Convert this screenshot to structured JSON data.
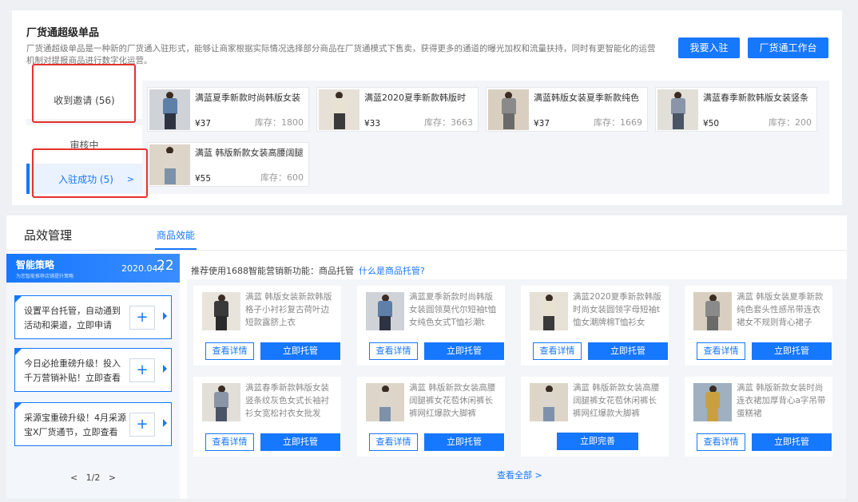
{
  "top": {
    "title": "厂货通超级单品",
    "desc": "厂货通超级单品是一种新的厂货通入驻形式，能够让商家根据实际情况选择部分商品在厂货通模式下售卖，获得更多的通道的曝光加权和流量扶持，同时有更智能化的运营机制对提报商品进行数字化运营。",
    "join_label": "我要入驻",
    "workbench_label": "厂货通工作台",
    "tabs": {
      "invite": "收到邀请 (56)",
      "review": "审核中",
      "success": "入驻成功 (5)",
      "success_chev": ">"
    },
    "products": [
      {
        "name": "满蓝夏季新款时尚韩版女装",
        "price": "¥37",
        "stock": "库存：1800",
        "top_color": "#5d7fa8",
        "bottom_color": "#2d3340",
        "bg": "#cfd3d8"
      },
      {
        "name": "满蓝2020夏季新款韩版时",
        "price": "¥33",
        "stock": "库存：3663",
        "top_color": "#e8e2d2",
        "bottom_color": "#3a3a3a",
        "bg": "#e6e0d6"
      },
      {
        "name": "满蓝韩版女装夏季新款纯色",
        "price": "¥37",
        "stock": "库存：1669",
        "top_color": "#8a8a8a",
        "bottom_color": "#6a6a6a",
        "bg": "#d8cfc0"
      },
      {
        "name": "满蓝春季新款韩版女装竖条",
        "price": "¥50",
        "stock": "库存：200",
        "top_color": "#8a95a8",
        "bottom_color": "#4b5466",
        "bg": "#e2dfd8"
      },
      {
        "name": "满蓝 韩版新款女装高腰阔腿",
        "price": "¥55",
        "stock": "库存：600",
        "top_color": "#dcd6cc",
        "bottom_color": "#7d91aa",
        "bg": "#ddd5c8"
      }
    ]
  },
  "perf": {
    "title": "品效管理",
    "tab": "商品效能",
    "strategy": {
      "title": "智能策略",
      "subtitle": "为您智能推荐店铺提升策略",
      "date": "2020.04 /",
      "day": "22",
      "cards": [
        {
          "text": "设置平台托管，自动通到活动和渠道，立即申请",
          "plus": "+"
        },
        {
          "text": "今日必抢重磅升级！投入千万营销补贴！立即查看",
          "plus": "+"
        },
        {
          "text": "采源宝重磅升级！4月采源宝X厂货通节，立即查看",
          "plus": "+"
        }
      ],
      "pager": "<   1/2   >"
    },
    "reco_text": "推荐使用1688智能营销新功能：商品托管",
    "reco_link": "什么是商品托管?",
    "detail_label": "查看详情",
    "host_label": "立即托管",
    "complete_label": "立即完善",
    "view_all": "查看全部 >",
    "items": [
      {
        "name": "满蓝 韩版女装新款韩版格子小衬衫复古荷叶边短款露脐上衣",
        "top_color": "#3a3a3a",
        "bottom_color": "#2a2a2a",
        "bg": "#e8e4dc"
      },
      {
        "name": "满蓝夏季新款时尚韩版女装圆领莫代尔短袖t恤女纯色女式T恤衫潮t",
        "top_color": "#5d7fa8",
        "bottom_color": "#2d3340",
        "bg": "#cfd3d8"
      },
      {
        "name": "满蓝2020夏季新款韩版时尚女装圆领字母短袖t恤女潮牌棉T恤衫女",
        "top_color": "#e8e2d2",
        "bottom_color": "#3a3a3a",
        "bg": "#e6e0d6"
      },
      {
        "name": "满蓝 韩版女装夏季新款纯色套头性感吊带连衣裙女不规则背心裙子",
        "top_color": "#8a8a8a",
        "bottom_color": "#6a6a6a",
        "bg": "#d8cfc0"
      },
      {
        "name": "满蓝春季新款韩版女装竖条纹灰色女式长袖衬衫女宽松衬衣女批发",
        "top_color": "#8a95a8",
        "bottom_color": "#4b5466",
        "bg": "#e2dfd8"
      },
      {
        "name": "满蓝 韩版新款女装高腰阔腿裤女花苞休闲裤长裤网红爆款大脚裤",
        "top_color": "#dcd6cc",
        "bottom_color": "#7d91aa",
        "bg": "#ddd5c8"
      },
      {
        "name": "满蓝 韩版新款女装高腰阔腿裤女花苞休闲裤长裤网红爆款大脚裤",
        "top_color": "#dcd6cc",
        "bottom_color": "#7d91aa",
        "bg": "#ddd5c8"
      },
      {
        "name": "满蓝 韩版新款女装时尚连衣裙加厚背心a字吊带蛋糕裙",
        "top_color": "#c9a040",
        "bottom_color": "#c9a040",
        "bg": "#9fb0c0"
      }
    ]
  }
}
